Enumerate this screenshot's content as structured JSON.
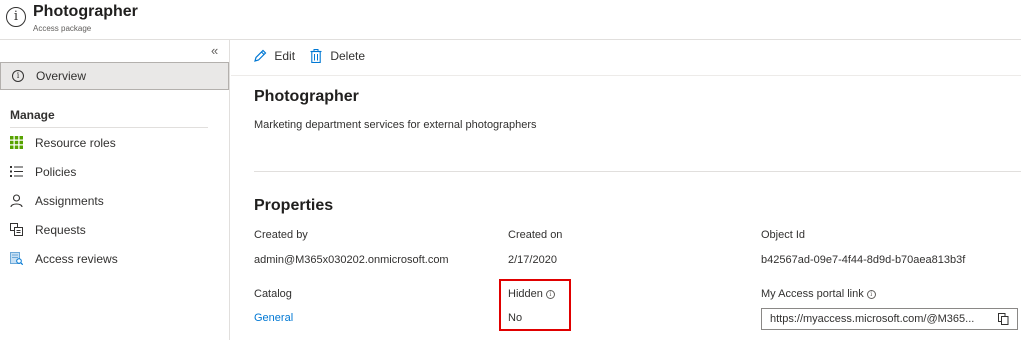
{
  "header": {
    "title": "Photographer",
    "subtitle": "Access package"
  },
  "sidebar": {
    "collapse_glyph": "«",
    "overview_label": "Overview",
    "manage_heading": "Manage",
    "items": [
      {
        "label": "Resource roles",
        "icon": "grid-icon"
      },
      {
        "label": "Policies",
        "icon": "list-icon"
      },
      {
        "label": "Assignments",
        "icon": "person-icon"
      },
      {
        "label": "Requests",
        "icon": "requests-icon"
      },
      {
        "label": "Access reviews",
        "icon": "access-review-icon"
      }
    ]
  },
  "toolbar": {
    "edit_label": "Edit",
    "delete_label": "Delete"
  },
  "package": {
    "title": "Photographer",
    "description": "Marketing department services for external photographers"
  },
  "properties": {
    "heading": "Properties",
    "created_by_label": "Created by",
    "created_by_value": "admin@M365x030202.onmicrosoft.com",
    "created_on_label": "Created on",
    "created_on_value": "2/17/2020",
    "object_id_label": "Object Id",
    "object_id_value": "b42567ad-09e7-4f44-8d9d-b70aea813b3f",
    "catalog_label": "Catalog",
    "catalog_value": "General",
    "hidden_label": "Hidden",
    "hidden_value": "No",
    "portal_link_label": "My Access portal link",
    "portal_link_value": "https://myaccess.microsoft.com/@M365..."
  },
  "colors": {
    "accent": "#0078d4",
    "highlight": "#e00000",
    "resource_roles_icon": "#57a300"
  }
}
